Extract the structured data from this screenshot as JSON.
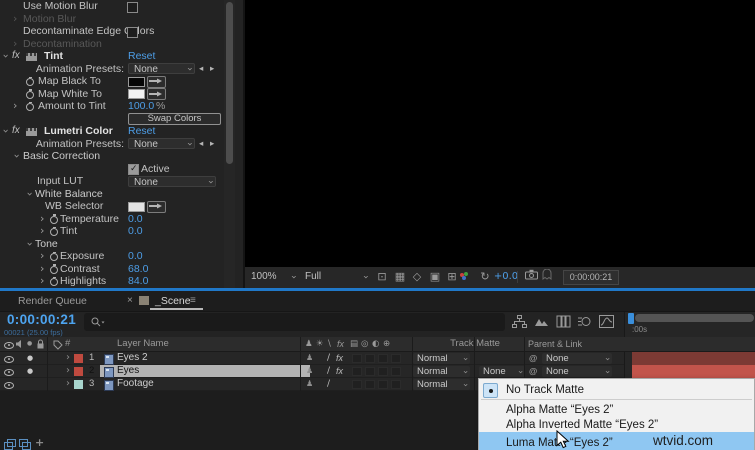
{
  "colors": {
    "accent_blue": "#4d9de6",
    "timecode_blue": "#4da4f0",
    "divider_blue": "#2078c8",
    "menu_highlight": "#8fc7f2",
    "label_red": "#bf4a3f",
    "label_aqua": "#a9d6ce",
    "bar_red_dim": "#7c3a34",
    "bar_red_bright": "#c2544b"
  },
  "glyphs": {
    "chevron": "›",
    "solo": "●",
    "shy": "♟",
    "collapse": "☀",
    "quality": "\\",
    "fx": "fx",
    "frame_blend": "▤",
    "motion_blur": "◎",
    "adjustment": "◐",
    "threed": "⊕",
    "pickwhip": "@",
    "presets_prev": "◂",
    "presets_next": "▸",
    "refresh": "↻",
    "tab_close": "×",
    "tab_menu": "≡",
    "hash": "#",
    "plus": "+",
    "viewer_icons": [
      "⊡",
      "▦",
      "◇",
      "▣",
      "⊞"
    ]
  },
  "effects_panel": {
    "rows": [
      {
        "t": "check",
        "label": "Use Motion Blur",
        "checked": false
      },
      {
        "t": "dim",
        "label": "Motion Blur"
      },
      {
        "t": "check",
        "label": "Decontaminate Edge Colors",
        "checked": false
      },
      {
        "t": "dim",
        "label": "Decontamination"
      },
      {
        "t": "fxhead",
        "label": "Tint",
        "action": "Reset"
      },
      {
        "t": "presets",
        "label": "Animation Presets:",
        "value": "None"
      },
      {
        "t": "swatch",
        "label": "Map Black To",
        "color": "#060606",
        "stopwatch": true
      },
      {
        "t": "swatch",
        "label": "Map White To",
        "color": "#f2f2f2",
        "stopwatch": true
      },
      {
        "t": "val",
        "label": "Amount to Tint",
        "value": "100.0",
        "suffix": "%",
        "chev": true,
        "lvl": 0
      },
      {
        "t": "btn",
        "label": "Swap Colors"
      },
      {
        "t": "fxhead",
        "label": "Lumetri Color",
        "action": "Reset"
      },
      {
        "t": "presets",
        "label": "Animation Presets:",
        "value": "None"
      },
      {
        "t": "grp",
        "label": "Basic Correction",
        "lvl": 1
      },
      {
        "t": "activecheck",
        "label": "Active",
        "checked": true
      },
      {
        "t": "dd",
        "label": "Input LUT",
        "value": "None"
      },
      {
        "t": "grp",
        "label": "White Balance",
        "lvl": 2
      },
      {
        "t": "swatch",
        "label": "WB Selector",
        "color": "#e4e4e4",
        "stopwatch": false,
        "lvl": 2
      },
      {
        "t": "val",
        "label": "Temperature",
        "value": "0.0",
        "chev": true,
        "lvl": 2
      },
      {
        "t": "val",
        "label": "Tint",
        "value": "0.0",
        "chev": true,
        "lvl": 2
      },
      {
        "t": "grp",
        "label": "Tone",
        "lvl": 2
      },
      {
        "t": "val",
        "label": "Exposure",
        "value": "0.0",
        "chev": true,
        "lvl": 2
      },
      {
        "t": "val",
        "label": "Contrast",
        "value": "68.0",
        "chev": true,
        "lvl": 2
      },
      {
        "t": "val",
        "label": "Highlights",
        "value": "84.0",
        "chev": true,
        "lvl": 2
      }
    ]
  },
  "viewer": {
    "zoom_level": "100%",
    "resolution": "Full",
    "exposure": "+0.0",
    "timecode": "0:00:00:21"
  },
  "timeline": {
    "tab_render_queue": "Render Queue",
    "tab_scene": "_Scene",
    "timecode": "0:00:00:21",
    "timecode_sub": "00021 (25.00 fps)",
    "ruler_label": ":00s",
    "col_layer_name": "Layer Name",
    "col_track_matte": "Track Matte",
    "col_parent": "Parent & Link",
    "layers": [
      {
        "num": "1",
        "name": "Eyes 2",
        "label_color": "#bf4a3f",
        "solo": true,
        "fx": true,
        "mode": "Normal",
        "track_matte": null,
        "parent": "None",
        "selected": false,
        "bar_color": "#7c3a34"
      },
      {
        "num": "2",
        "name": "Eyes",
        "label_color": "#bf4a3f",
        "solo": true,
        "fx": true,
        "mode": "Normal",
        "track_matte": "None",
        "parent": "None",
        "selected": true,
        "bar_color": "#c2544b"
      },
      {
        "num": "3",
        "name": "Footage",
        "label_color": "#a9d6ce",
        "solo": false,
        "fx": false,
        "mode": "Normal",
        "track_matte": null,
        "parent": null,
        "selected": false,
        "bar_color": null
      }
    ]
  },
  "context_menu": {
    "items": [
      {
        "label": "No Track Matte",
        "selected": true
      },
      {
        "separator": true
      },
      {
        "label": "Alpha Matte “Eyes 2”"
      },
      {
        "label": "Alpha Inverted Matte “Eyes 2”"
      },
      {
        "label": "Luma Matte “Eyes 2”",
        "highlighted": true
      }
    ]
  },
  "watermark": "wtvid.com"
}
